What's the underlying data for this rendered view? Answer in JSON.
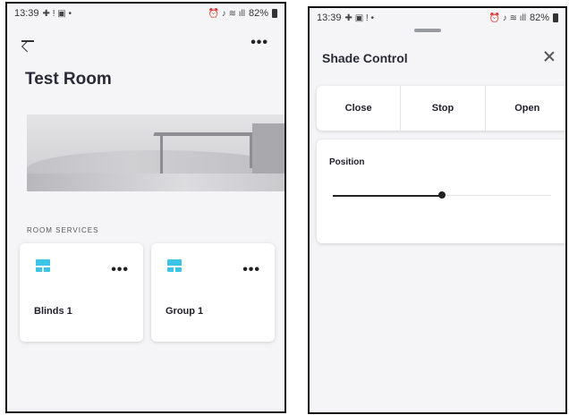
{
  "left_screen": {
    "status": {
      "time": "13:39",
      "battery": "82%"
    },
    "title": "Test Room",
    "section_label": "ROOM SERVICES",
    "cards": [
      {
        "name": "Blinds 1",
        "icon": "blind-icon"
      },
      {
        "name": "Group 1",
        "icon": "blind-icon"
      }
    ],
    "more_label": "•••"
  },
  "right_screen": {
    "status": {
      "time": "13:39",
      "battery": "82%"
    },
    "title": "Shade Control",
    "buttons": {
      "close": "Close",
      "stop": "Stop",
      "open": "Open"
    },
    "position": {
      "label": "Position",
      "value_fraction": 0.5
    }
  },
  "colors": {
    "accent": "#3cc3e8",
    "background": "#f5f5f7",
    "card": "#ffffff",
    "text": "#1f1f2b"
  }
}
